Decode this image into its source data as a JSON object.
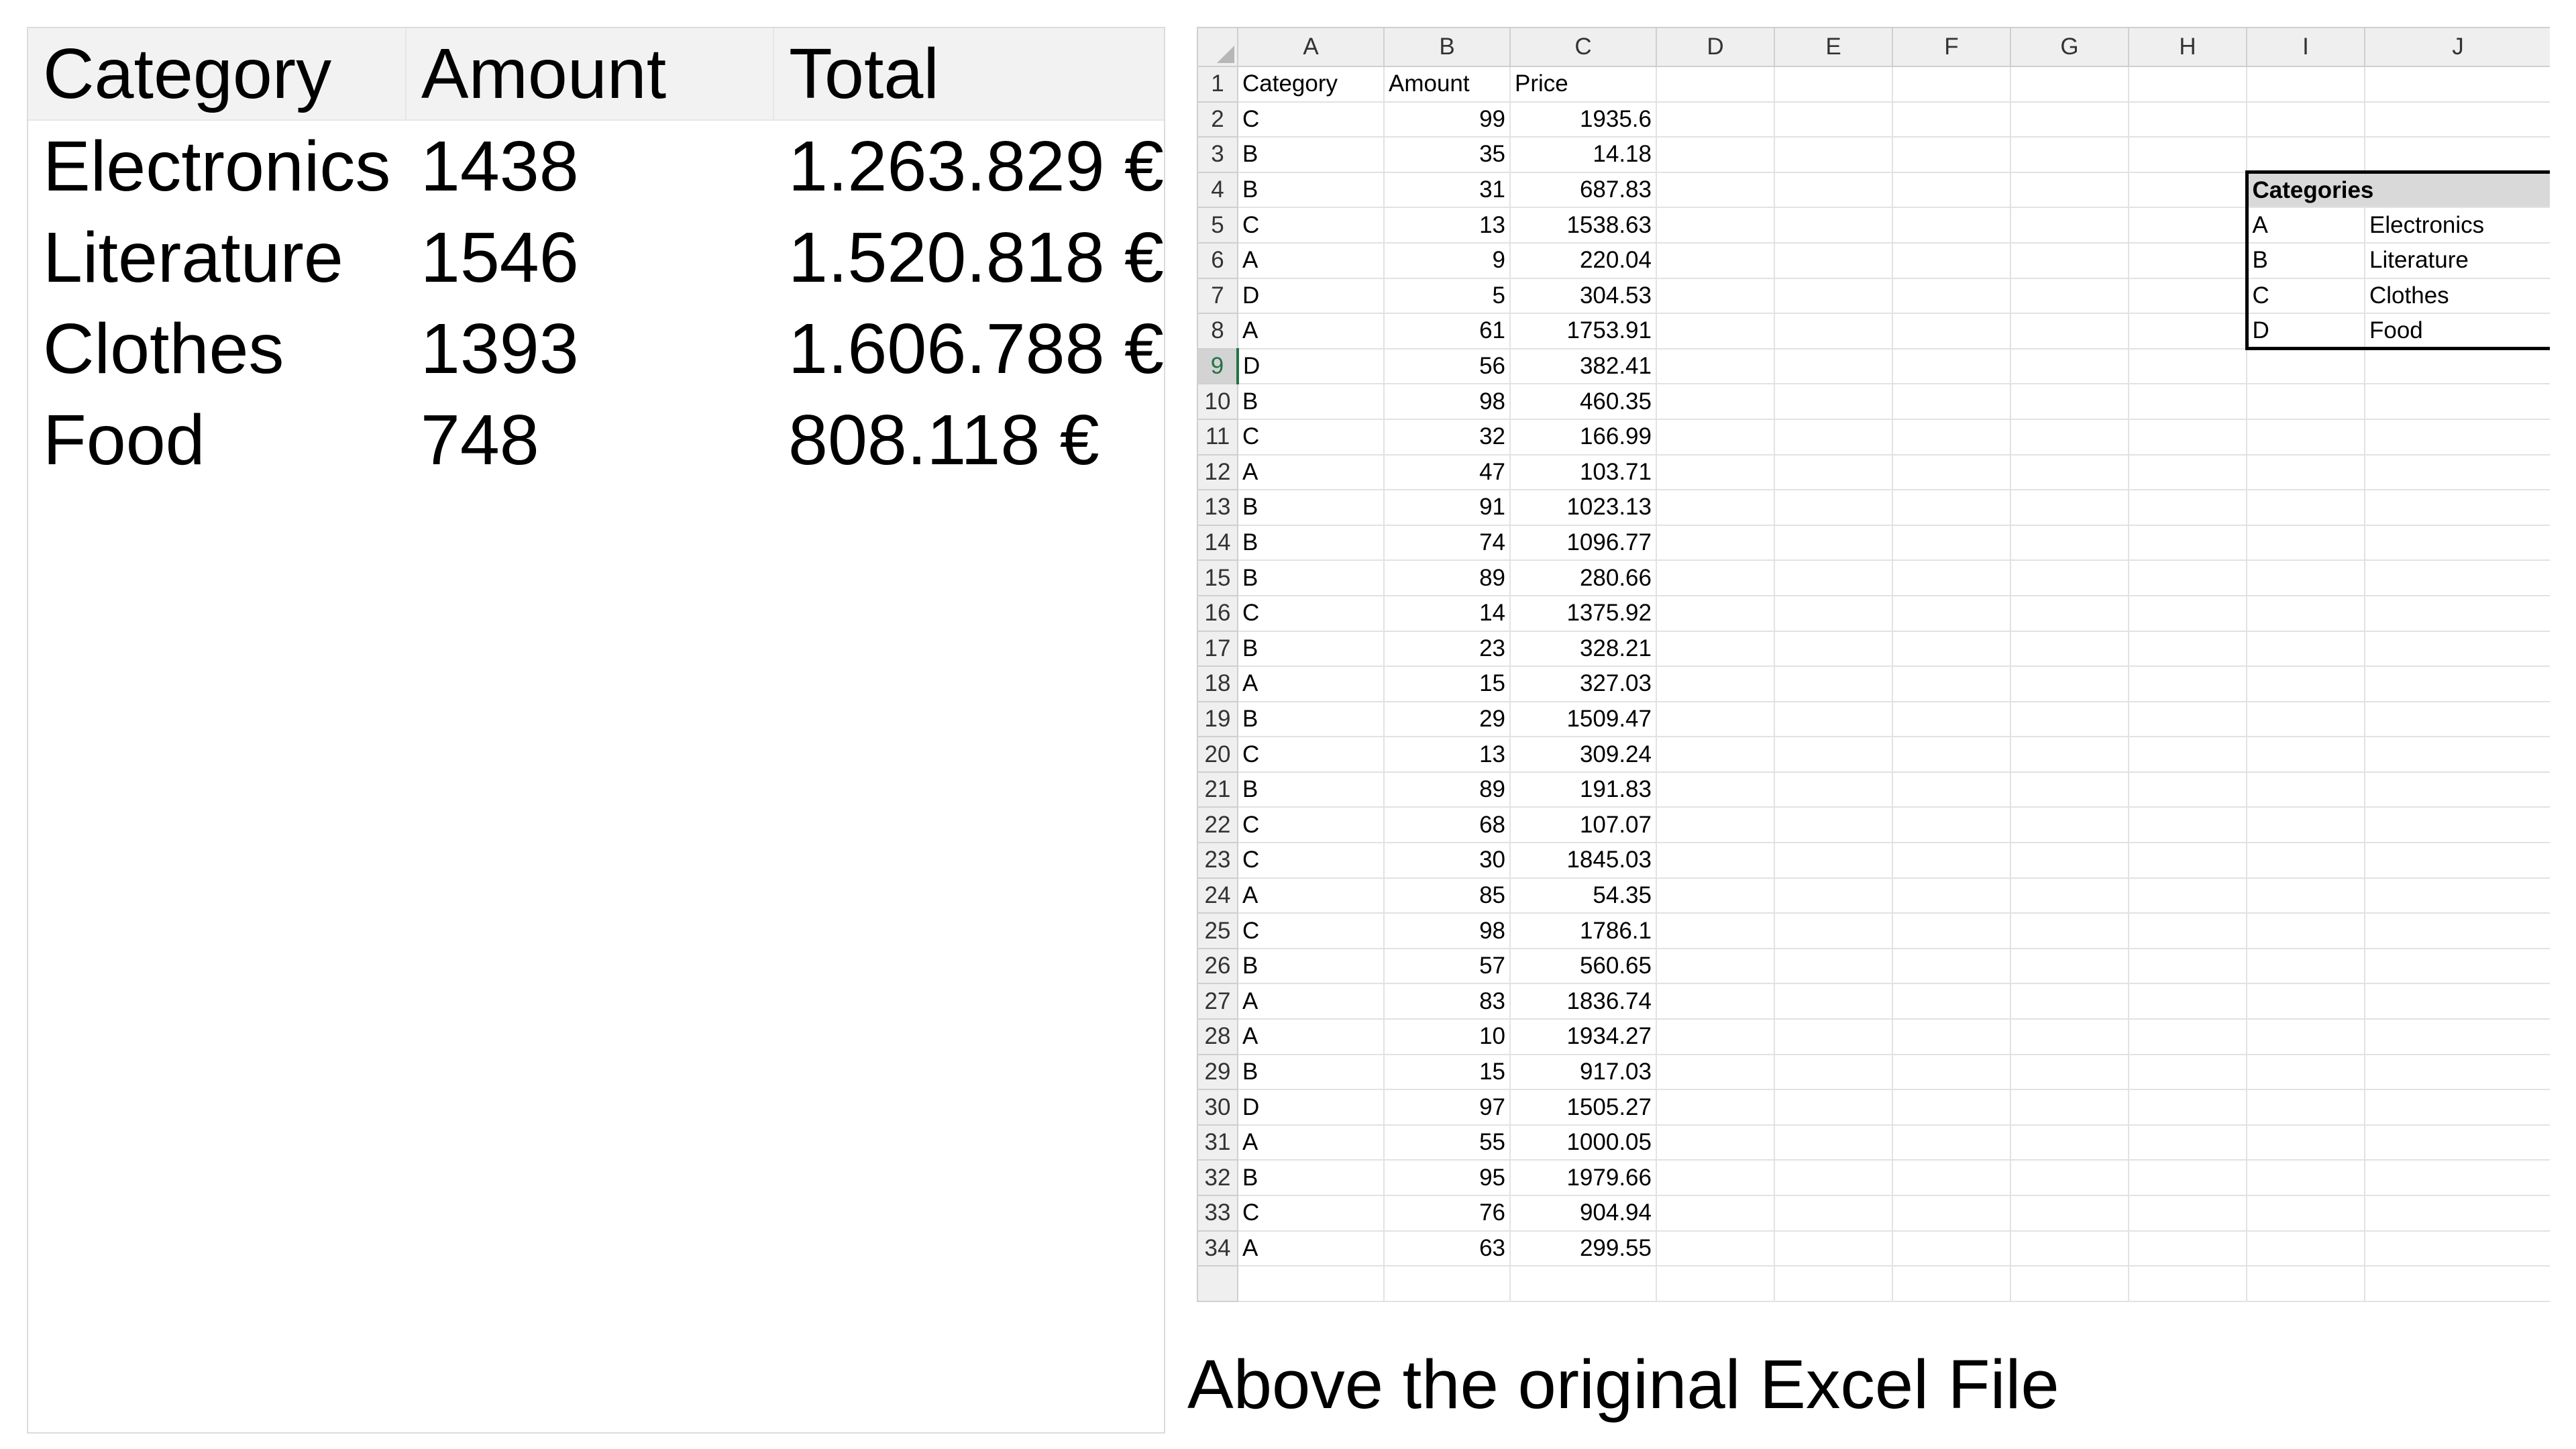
{
  "summary": {
    "headers": [
      "Category",
      "Amount",
      "Total"
    ],
    "rows": [
      [
        "Electronics",
        "1438",
        "1.263.829 €"
      ],
      [
        "Literature",
        "1546",
        "1.520.818 €"
      ],
      [
        "Clothes",
        "1393",
        "1.606.788 €"
      ],
      [
        "Food",
        "748",
        "808.118 €"
      ]
    ]
  },
  "spreadsheet": {
    "column_letters": [
      "A",
      "B",
      "C",
      "D",
      "E",
      "F",
      "G",
      "H",
      "I",
      "J"
    ],
    "selected_row": 9,
    "header_row": [
      "Category",
      "Amount",
      "Price"
    ],
    "rows": [
      [
        "C",
        "99",
        "1935.6"
      ],
      [
        "B",
        "35",
        "14.18"
      ],
      [
        "B",
        "31",
        "687.83"
      ],
      [
        "C",
        "13",
        "1538.63"
      ],
      [
        "A",
        "9",
        "220.04"
      ],
      [
        "D",
        "5",
        "304.53"
      ],
      [
        "A",
        "61",
        "1753.91"
      ],
      [
        "D",
        "56",
        "382.41"
      ],
      [
        "B",
        "98",
        "460.35"
      ],
      [
        "C",
        "32",
        "166.99"
      ],
      [
        "A",
        "47",
        "103.71"
      ],
      [
        "B",
        "91",
        "1023.13"
      ],
      [
        "B",
        "74",
        "1096.77"
      ],
      [
        "B",
        "89",
        "280.66"
      ],
      [
        "C",
        "14",
        "1375.92"
      ],
      [
        "B",
        "23",
        "328.21"
      ],
      [
        "A",
        "15",
        "327.03"
      ],
      [
        "B",
        "29",
        "1509.47"
      ],
      [
        "C",
        "13",
        "309.24"
      ],
      [
        "B",
        "89",
        "191.83"
      ],
      [
        "C",
        "68",
        "107.07"
      ],
      [
        "C",
        "30",
        "1845.03"
      ],
      [
        "A",
        "85",
        "54.35"
      ],
      [
        "C",
        "98",
        "1786.1"
      ],
      [
        "B",
        "57",
        "560.65"
      ],
      [
        "A",
        "83",
        "1836.74"
      ],
      [
        "A",
        "10",
        "1934.27"
      ],
      [
        "B",
        "15",
        "917.03"
      ],
      [
        "D",
        "97",
        "1505.27"
      ],
      [
        "A",
        "55",
        "1000.05"
      ],
      [
        "B",
        "95",
        "1979.66"
      ],
      [
        "C",
        "76",
        "904.94"
      ],
      [
        "A",
        "63",
        "299.55"
      ]
    ],
    "legend": {
      "title": "Categories",
      "items": [
        [
          "A",
          "Electronics"
        ],
        [
          "B",
          "Literature"
        ],
        [
          "C",
          "Clothes"
        ],
        [
          "D",
          "Food"
        ]
      ]
    }
  },
  "caption": "Above the original Excel File"
}
